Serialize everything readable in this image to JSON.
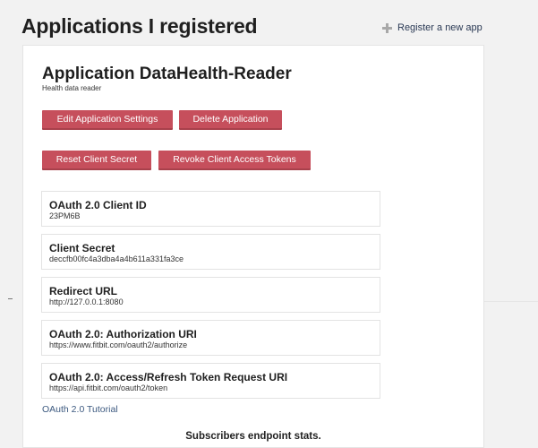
{
  "page": {
    "title": "Applications I registered",
    "register_link": "Register a new app"
  },
  "app": {
    "title": "Application DataHealth-Reader",
    "subtitle": "Health data reader"
  },
  "buttons": {
    "edit": "Edit Application Settings",
    "delete": "Delete Application",
    "reset_secret": "Reset Client Secret",
    "revoke_tokens": "Revoke Client Access Tokens"
  },
  "fields": [
    {
      "label": "OAuth 2.0 Client ID",
      "value": "23PM6B"
    },
    {
      "label": "Client Secret",
      "value": "deccfb00fc4a3dba4a4b611a331fa3ce"
    },
    {
      "label": "Redirect URL",
      "value": "http://127.0.0.1:8080"
    },
    {
      "label": "OAuth 2.0: Authorization URI",
      "value": "https://www.fitbit.com/oauth2/authorize"
    },
    {
      "label": "OAuth 2.0: Access/Refresh Token Request URI",
      "value": "https://api.fitbit.com/oauth2/token"
    }
  ],
  "tutorial_link": "OAuth 2.0 Tutorial",
  "subscribers_heading": "Subscribers endpoint stats.",
  "icons": {
    "register": "plus-icon"
  },
  "colors": {
    "button": "#c64f5c",
    "link": "#3d5a80"
  }
}
